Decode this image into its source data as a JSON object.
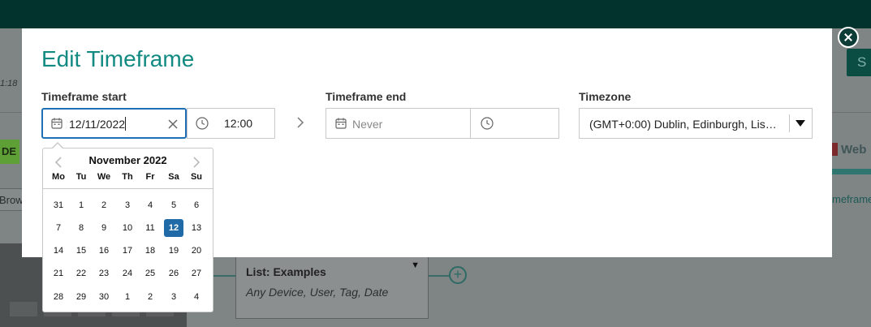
{
  "background": {
    "time_fragment": "1:18",
    "chip_text": "DE",
    "browse_text": "Brow",
    "right_button_text": "S",
    "web_text": "Web",
    "timeframe_text": "meframe",
    "node": {
      "title": "List: Examples",
      "subtitle": "Any Device, User, Tag, Date"
    }
  },
  "modal": {
    "title": "Edit Timeframe",
    "start": {
      "label": "Timeframe start",
      "date_value": "12/11/2022",
      "time_value": "12:00"
    },
    "end": {
      "label": "Timeframe end",
      "date_placeholder": "Never",
      "time_value": ""
    },
    "timezone": {
      "label": "Timezone",
      "selected": "(GMT+0:00) Dublin, Edinburgh, Lis…"
    }
  },
  "datepicker": {
    "month_label": "November 2022",
    "weekdays": [
      "Mo",
      "Tu",
      "We",
      "Th",
      "Fr",
      "Sa",
      "Su"
    ],
    "weeks": [
      [
        "31",
        "1",
        "2",
        "3",
        "4",
        "5",
        "6"
      ],
      [
        "7",
        "8",
        "9",
        "10",
        "11",
        "12",
        "13"
      ],
      [
        "14",
        "15",
        "16",
        "17",
        "18",
        "19",
        "20"
      ],
      [
        "21",
        "22",
        "23",
        "24",
        "25",
        "26",
        "27"
      ],
      [
        "28",
        "29",
        "30",
        "1",
        "2",
        "3",
        "4"
      ]
    ],
    "selected_day": "12"
  },
  "colors": {
    "accent": "#128a82",
    "selected_day_bg": "#216aa8",
    "focus_border": "#1e6fb3"
  }
}
